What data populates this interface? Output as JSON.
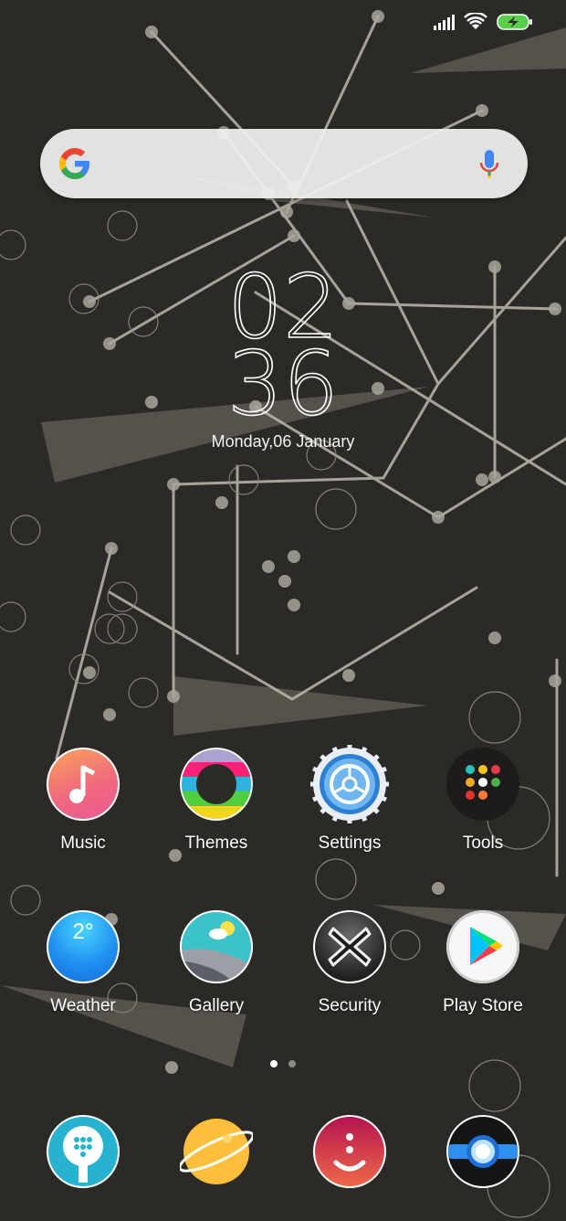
{
  "clock": {
    "hour": "02",
    "minute": "36",
    "date": "Monday,06 January"
  },
  "apps_row1": [
    {
      "name": "music-app",
      "label": "Music",
      "icon": "music-note-icon"
    },
    {
      "name": "themes-app",
      "label": "Themes",
      "icon": "themes-icon"
    },
    {
      "name": "settings-app",
      "label": "Settings",
      "icon": "gear-icon"
    },
    {
      "name": "tools-app",
      "label": "Tools",
      "icon": "folder-icon"
    }
  ],
  "apps_row2": [
    {
      "name": "weather-app",
      "label": "Weather",
      "icon": "weather-icon",
      "temp": "2°"
    },
    {
      "name": "gallery-app",
      "label": "Gallery",
      "icon": "gallery-icon"
    },
    {
      "name": "security-app",
      "label": "Security",
      "icon": "security-icon"
    },
    {
      "name": "play-store-app",
      "label": "Play Store",
      "icon": "play-store-icon"
    }
  ],
  "dock": [
    {
      "name": "phone-dock-app",
      "icon": "phone-icon"
    },
    {
      "name": "browser-dock-app",
      "icon": "planet-icon"
    },
    {
      "name": "messages-dock-app",
      "icon": "smiley-icon"
    },
    {
      "name": "camera-dock-app",
      "icon": "camera-icon"
    }
  ],
  "page_indicator": {
    "count": 2,
    "active": 0
  },
  "colors": {
    "background": "#2b2a27",
    "line": "#bdb9ad",
    "accent": "#ffffff"
  }
}
